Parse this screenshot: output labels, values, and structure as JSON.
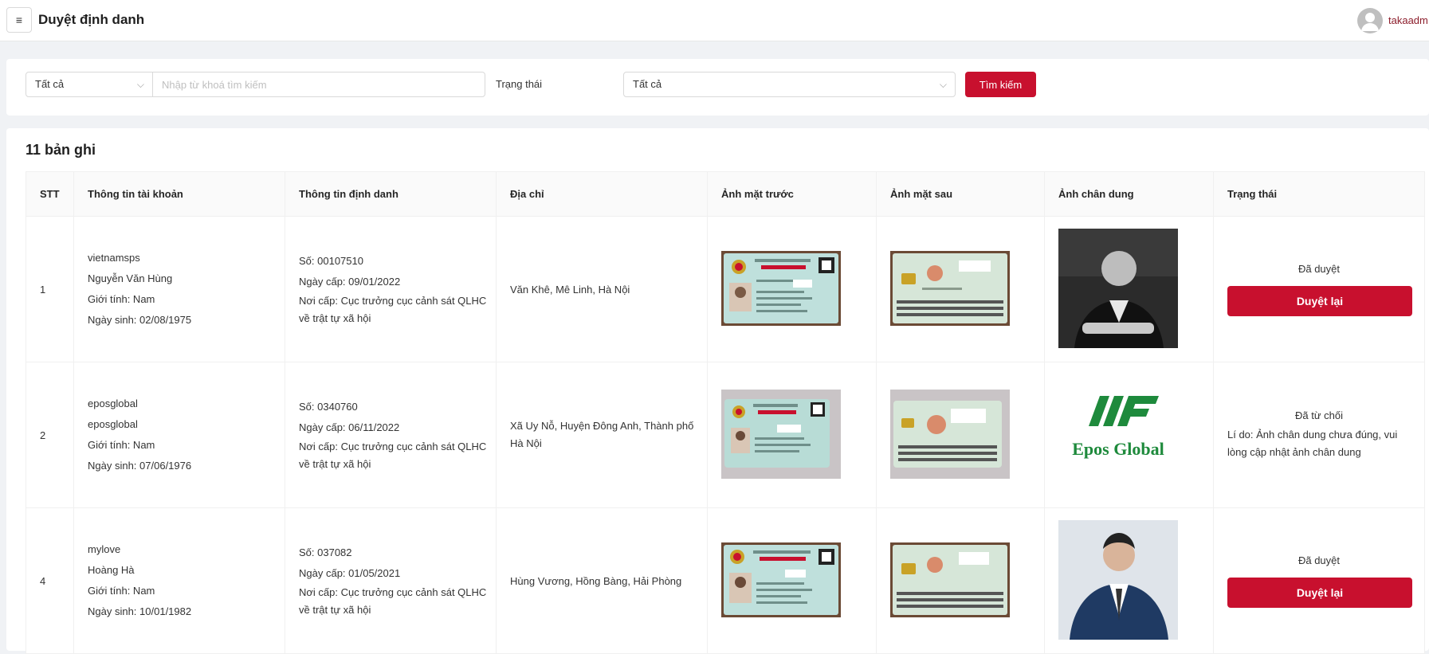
{
  "header": {
    "menu_icon": "hamburger-menu-icon",
    "title": "Duyệt định danh",
    "user": {
      "avatar_icon": "user-avatar-icon",
      "name": "takaadm"
    }
  },
  "filter": {
    "type_select": {
      "value": "Tất cả"
    },
    "search": {
      "placeholder": "Nhập từ khoá tìm kiếm",
      "value": ""
    },
    "status_label": "Trạng thái",
    "status_select": {
      "value": "Tất cả"
    },
    "search_button": "Tìm kiếm"
  },
  "records_count": "11 bản ghi",
  "table": {
    "columns": [
      "STT",
      "Thông tin tài khoản",
      "Thông tin định danh",
      "Địa chỉ",
      "Ảnh mặt trước",
      "Ảnh mặt sau",
      "Ảnh chân dung",
      "Trạng thái"
    ],
    "rows": [
      {
        "stt": "1",
        "account": [
          "vietnamsps",
          "Nguyễn Văn Hùng",
          "Giới tính: Nam",
          "Ngày sinh: 02/08/1975"
        ],
        "identity": {
          "number": "Số: 00107510",
          "issued": "Ngày cấp: 09/01/2022",
          "place": "Nơi cấp: Cục trưởng cục cảnh sát QLHC về trật tự xã hội"
        },
        "address": "Văn Khê, Mê Linh, Hà Nội",
        "portrait": "portrait-photo-man-black-white",
        "status": "Đã duyệt",
        "reason": "",
        "action": "Duyệt lại"
      },
      {
        "stt": "2",
        "account": [
          "eposglobal",
          "eposglobal",
          "Giới tính: Nam",
          "Ngày sinh: 07/06/1976"
        ],
        "identity": {
          "number": "Số: 0340760",
          "issued": "Ngày cấp: 06/11/2022",
          "place": "Nơi cấp: Cục trưởng cục cảnh sát QLHC về trật tự xã hội"
        },
        "address": "Xã Uy Nỗ, Huyện Đông Anh, Thành phố Hà Nội",
        "portrait": "epos-global-logo",
        "portrait_logo_text": "Epos Global",
        "status": "Đã từ chối",
        "reason": "Lí do: Ảnh chân dung chưa đúng, vui lòng cập nhật ảnh chân dung",
        "action": ""
      },
      {
        "stt": "4",
        "account": [
          "mylove",
          "Hoàng Hà",
          "Giới tính: Nam",
          "Ngày sinh: 10/01/1982"
        ],
        "identity": {
          "number": "Số: 037082",
          "issued": "Ngày cấp: 01/05/2021",
          "place": "Nơi cấp: Cục trưởng cục cảnh sát QLHC về trật tự xã hội"
        },
        "address": "Hùng Vương, Hồng Bàng, Hải Phòng",
        "portrait": "portrait-photo-man-suit",
        "status": "Đã duyệt",
        "reason": "",
        "action": "Duyệt lại"
      }
    ]
  },
  "colors": {
    "primary": "#c8102e",
    "logo_green": "#1e8a3c"
  }
}
